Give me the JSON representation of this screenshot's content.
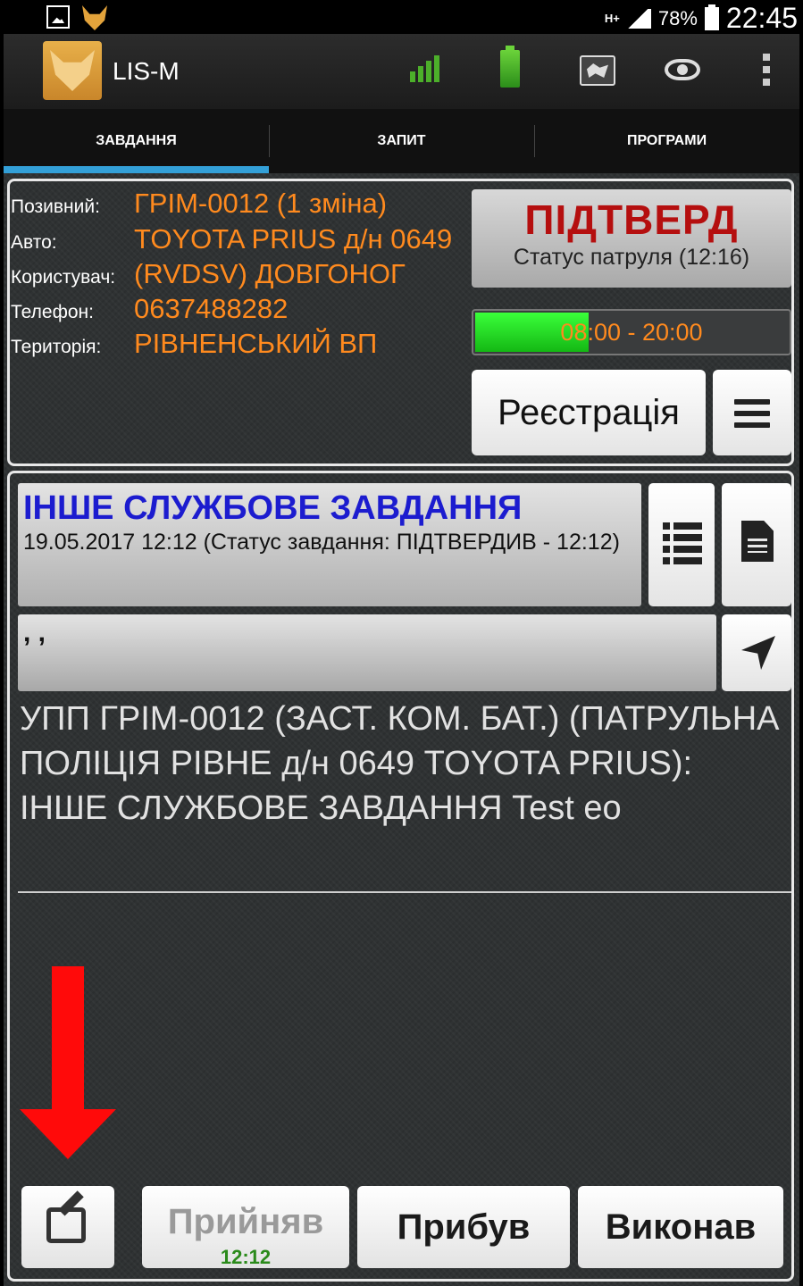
{
  "status_bar": {
    "network": "H+",
    "battery_percent": "78%",
    "time": "22:45"
  },
  "action_bar": {
    "app_title": "LIS-M"
  },
  "tabs": [
    {
      "label": "ЗАВДАННЯ",
      "active": true
    },
    {
      "label": "ЗАПИТ",
      "active": false
    },
    {
      "label": "ПРОГРАМИ",
      "active": false
    }
  ],
  "info": {
    "callsign_label": "Позивний:",
    "callsign_value": "ГРІМ-0012 (1 зміна)",
    "car_label": "Авто:",
    "car_value": "TOYOTA PRIUS д/н 0649",
    "user_label": "Користувач:",
    "user_value": "(RVDSV) ДОВГОНОГ",
    "phone_label": "Телефон:",
    "phone_value": "0637488282",
    "territory_label": "Територія:",
    "territory_value": "РІВНЕНСЬКИЙ ВП"
  },
  "patrol_status": {
    "title": "ПІДТВЕРД",
    "subtitle": "Статус патруля (12:16)"
  },
  "shift": {
    "range": "08:00 - 20:00",
    "progress_fraction": 0.36
  },
  "buttons": {
    "register": "Реєстрація",
    "accepted": "Прийняв",
    "accepted_time": "12:12",
    "arrived": "Прибув",
    "done": "Виконав"
  },
  "task": {
    "title": "ІНШЕ СЛУЖБОВЕ ЗАВДАННЯ",
    "date_status": "19.05.2017 12:12 (Статус завдання: ПІДТВЕРДИВ - 12:12)",
    "address": ", ,",
    "description": "УПП ГРІМ-0012 (ЗАСТ. КОМ. БАТ.) (ПАТРУЛЬНА ПОЛІЦІЯ РІВНЕ д/н 0649 TOYOTA PRIUS): ІНШЕ СЛУЖБОВЕ ЗАВДАННЯ Test eo"
  },
  "colors": {
    "accent_tab": "#33a0d8",
    "value_orange": "#ff8a1e",
    "status_red": "#b50f0f",
    "task_title_blue": "#1c1ccf",
    "annotation_arrow": "#ff0a0a"
  }
}
